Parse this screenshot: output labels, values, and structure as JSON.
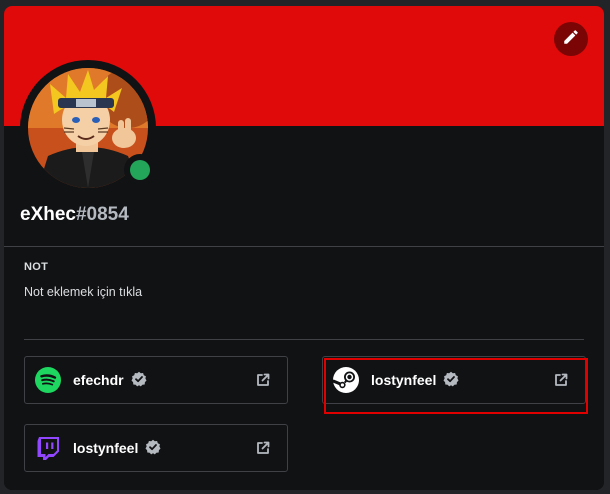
{
  "profile": {
    "username": "eXhec",
    "discriminator": "#0854",
    "banner_color": "#e00a0a",
    "status": "online",
    "status_color": "#23a55a"
  },
  "note": {
    "heading": "NOT",
    "placeholder": "Not eklemek için tıkla"
  },
  "connections": [
    {
      "service": "spotify",
      "icon": "spotify-icon",
      "name": "efechdr",
      "verified": true,
      "brand_color": "#1ed760"
    },
    {
      "service": "steam",
      "icon": "steam-icon",
      "name": "lostynfeel",
      "verified": true,
      "brand_color": "#ffffff",
      "highlighted": true
    },
    {
      "service": "twitch",
      "icon": "twitch-icon",
      "name": "lostynfeel",
      "verified": true,
      "brand_color": "#9146ff"
    }
  ],
  "highlight_color": "#e00000"
}
